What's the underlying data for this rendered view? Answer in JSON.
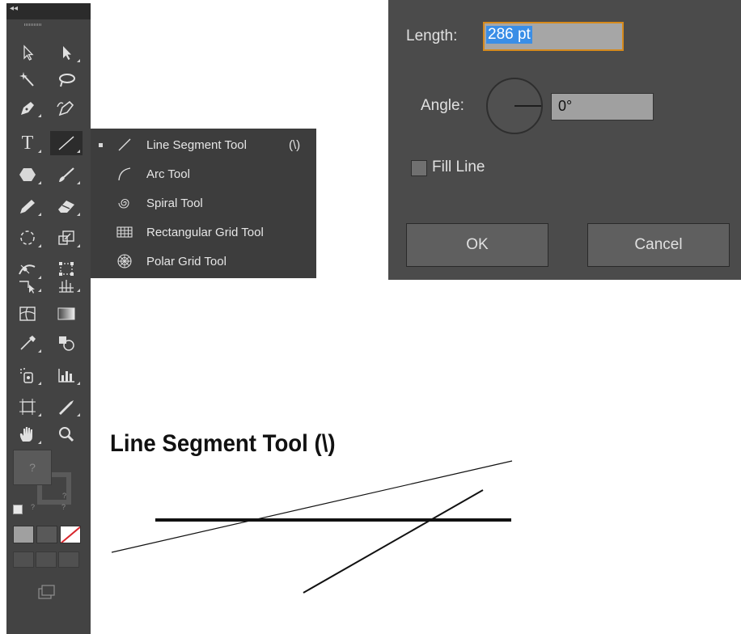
{
  "toolbar": {
    "collapse_label": "◂◂",
    "tools": [
      {
        "name": "selection-tool",
        "icon": "arrow-icon"
      },
      {
        "name": "direct-selection-tool",
        "icon": "white-arrow-icon"
      },
      {
        "name": "magic-wand-tool",
        "icon": "magic-wand-icon"
      },
      {
        "name": "lasso-tool",
        "icon": "lasso-icon"
      },
      {
        "name": "pen-tool",
        "icon": "pen-icon"
      },
      {
        "name": "curvature-tool",
        "icon": "curvature-icon"
      },
      {
        "name": "type-tool",
        "icon": "type-icon",
        "letter": "T"
      },
      {
        "name": "line-segment-tool",
        "icon": "line-icon",
        "selected": true
      },
      {
        "name": "shape-tool",
        "icon": "hexagon-icon"
      },
      {
        "name": "paintbrush-tool",
        "icon": "brush-icon"
      },
      {
        "name": "pencil-tool",
        "icon": "pencil-icon"
      },
      {
        "name": "eraser-tool",
        "icon": "eraser-icon"
      },
      {
        "name": "rotate-tool",
        "icon": "rotate-icon"
      },
      {
        "name": "scale-tool",
        "icon": "scale-icon"
      },
      {
        "name": "width-tool",
        "icon": "width-icon"
      },
      {
        "name": "free-transform-tool",
        "icon": "free-transform-icon"
      },
      {
        "name": "mesh-tool",
        "icon": "mesh-icon"
      },
      {
        "name": "gradient-tool",
        "icon": "gradient-icon"
      },
      {
        "name": "eyedropper-tool",
        "icon": "eyedropper-icon"
      },
      {
        "name": "blend-tool",
        "icon": "blend-icon"
      },
      {
        "name": "symbol-sprayer-tool",
        "icon": "symbol-sprayer-icon"
      },
      {
        "name": "column-graph-tool",
        "icon": "column-graph-icon"
      },
      {
        "name": "artboard-tool",
        "icon": "artboard-icon"
      },
      {
        "name": "slice-tool",
        "icon": "slice-icon"
      },
      {
        "name": "hand-tool",
        "icon": "hand-icon"
      },
      {
        "name": "zoom-tool",
        "icon": "zoom-icon"
      }
    ],
    "fill_label": "?",
    "stroke_label": "?",
    "small_labels": [
      "?",
      "?"
    ]
  },
  "flyout": {
    "items": [
      {
        "label": "Line Segment Tool",
        "shortcut": "(\\)",
        "icon": "line-segment-icon",
        "active": true
      },
      {
        "label": "Arc Tool",
        "shortcut": "",
        "icon": "arc-icon",
        "active": false
      },
      {
        "label": "Spiral Tool",
        "shortcut": "",
        "icon": "spiral-icon",
        "active": false
      },
      {
        "label": "Rectangular Grid Tool",
        "shortcut": "",
        "icon": "rectangular-grid-icon",
        "active": false
      },
      {
        "label": "Polar Grid Tool",
        "shortcut": "",
        "icon": "polar-grid-icon",
        "active": false
      }
    ]
  },
  "dialog": {
    "length_label": "Length:",
    "length_value": "286 pt",
    "angle_label": "Angle:",
    "angle_value": "0°",
    "fill_line_label": "Fill Line",
    "fill_line_checked": false,
    "ok_label": "OK",
    "cancel_label": "Cancel"
  },
  "caption": "Line Segment Tool (\\)",
  "colors": {
    "panel_bg": "#434343",
    "flyout_bg": "#3d3d3d",
    "dialog_bg": "#4b4b4b",
    "focus_outline": "#d68a1c",
    "text_selection": "#3a8ee6"
  }
}
